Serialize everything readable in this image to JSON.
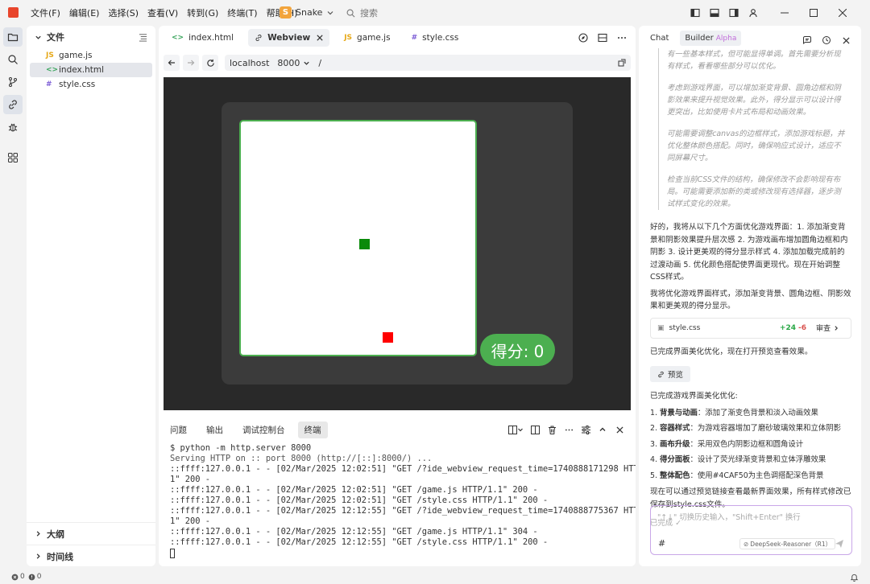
{
  "menu": [
    "文件(F)",
    "编辑(E)",
    "选择(S)",
    "查看(V)",
    "转到(G)",
    "终端(T)",
    "帮助(H)"
  ],
  "project": {
    "badge": "S",
    "name": "Snake"
  },
  "search": {
    "label": "搜索"
  },
  "explorer": {
    "title": "文件",
    "files": [
      {
        "icon": "JS",
        "name": "game.js",
        "color": "#e6a817"
      },
      {
        "icon": "<>",
        "name": "index.html",
        "color": "#3aa55d"
      },
      {
        "icon": "#",
        "name": "style.css",
        "color": "#7c5cd6"
      }
    ],
    "outline": "大纲",
    "timeline": "时间线"
  },
  "tabs": [
    {
      "icon": "<>",
      "label": "index.html",
      "color": "#3aa55d"
    },
    {
      "icon": "⊘",
      "label": "Webview",
      "color": "#333"
    },
    {
      "icon": "JS",
      "label": "game.js",
      "color": "#e6a817"
    },
    {
      "icon": "#",
      "label": "style.css",
      "color": "#7c5cd6"
    }
  ],
  "url": {
    "host": "localhost",
    "port": "8000",
    "path": "/"
  },
  "game": {
    "score_label": "得分: 0",
    "snake_color": "#0a8a0a",
    "food_color": "#ff0000",
    "accent": "#4caf50"
  },
  "panel_tabs": [
    "问题",
    "输出",
    "调试控制台",
    "终端"
  ],
  "terminal": [
    "$ python -m http.server 8000",
    "Serving HTTP on :: port 8000 (http://[::]:8000/) ...",
    "::ffff:127.0.0.1 - - [02/Mar/2025 12:02:51] \"GET /?ide_webview_request_time=1740888171298 HTTP/1.",
    "1\" 200 -",
    "::ffff:127.0.0.1 - - [02/Mar/2025 12:02:51] \"GET /game.js HTTP/1.1\" 200 -",
    "::ffff:127.0.0.1 - - [02/Mar/2025 12:02:51] \"GET /style.css HTTP/1.1\" 200 -",
    "::ffff:127.0.0.1 - - [02/Mar/2025 12:12:55] \"GET /?ide_webview_request_time=1740888775367 HTTP/1.",
    "1\" 200 -",
    "::ffff:127.0.0.1 - - [02/Mar/2025 12:12:55] \"GET /game.js HTTP/1.1\" 304 -",
    "::ffff:127.0.0.1 - - [02/Mar/2025 12:12:55] \"GET /style.css HTTP/1.1\" 200 -"
  ],
  "chat": {
    "tabs": [
      "Chat",
      "Builder"
    ],
    "alpha": "Alpha",
    "thinking": [
      "有一些基本样式，但可能显得单调。首先需要分析现有样式，看看哪些部分可以优化。",
      "考虑到游戏界面，可以增加渐变背景、圆角边框和阴影效果来提升视觉效果。此外，得分显示可以设计得更突出，比如使用卡片式布局和动画效果。",
      "可能需要调整canvas的边框样式，添加游戏标题，并优化整体颜色搭配。同时，确保响应式设计，适应不同屏幕尺寸。",
      "检查当前CSS文件的结构，确保修改不会影响现有布局。可能需要添加新的类或修改现有选择器，逐步测试样式变化的效果。"
    ],
    "msg1": "好的，我将从以下几个方面优化游戏界面：1. 添加渐变背景和阴影效果提升层次感 2. 为游戏画布增加圆角边框和内阴影 3. 设计更美观的得分显示样式 4. 添加加载完成前的过渡动画 5. 优化颜色搭配使界面更现代。现在开始调整CSS样式。",
    "msg2": "我将优化游戏界面样式，添加渐变背景、圆角边框、阴影效果和更美观的得分显示。",
    "file_card": {
      "name": "style.css",
      "added": "+24",
      "removed": "-6",
      "review": "审查"
    },
    "msg3": "已完成界面美化优化，现在打开预览查看效果。",
    "preview": "预览",
    "summary_title": "已完成游戏界面美化优化:",
    "steps": [
      {
        "n": "1.",
        "title": "背景与动画",
        "text": "：添加了渐变色背景和淡入动画效果"
      },
      {
        "n": "2.",
        "title": "容器样式",
        "text": "：为游戏容器增加了磨砂玻璃效果和立体阴影"
      },
      {
        "n": "3.",
        "title": "画布升级",
        "text": "：采用双色内阴影边框和圆角设计"
      },
      {
        "n": "4.",
        "title": "得分面板",
        "text": "：设计了荧光绿渐变背景和立体浮雕效果"
      },
      {
        "n": "5.",
        "title": "整体配色",
        "text": "：使用#4CAF50为主色调搭配深色背景"
      }
    ],
    "msg4": "现在可以通过预览链接查看最新界面效果，所有样式修改已保存到style.css文件。",
    "done": "已完成 ✓",
    "input_placeholder": "\"↑↓\" 切换历史输入，\"Shift+Enter\" 换行",
    "hash": "#",
    "model": "DeepSeek-Reasoner（R1）"
  },
  "status": {
    "errors": "0",
    "warnings": "0"
  }
}
